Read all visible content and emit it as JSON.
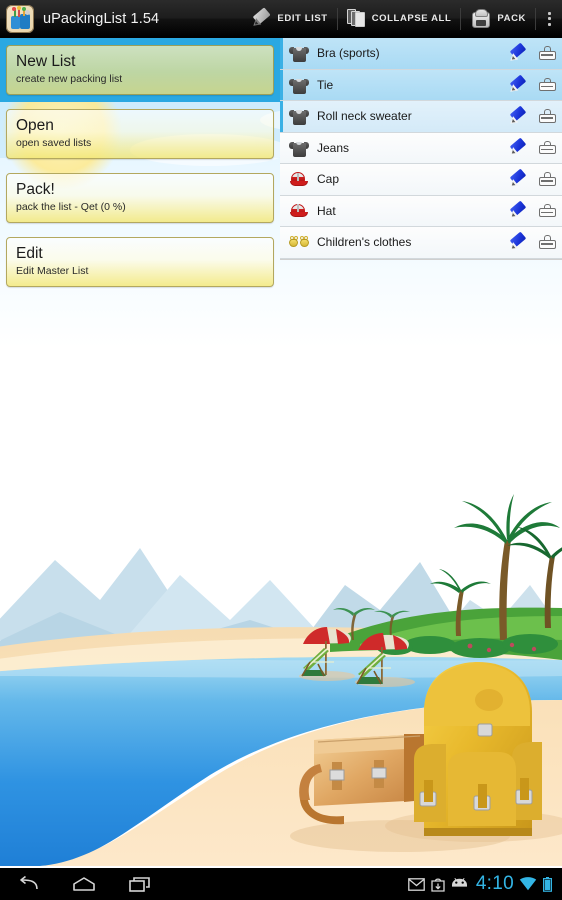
{
  "actionbar": {
    "app_icon": "app-gift-icon",
    "title": "uPackingList 1.54",
    "buttons": [
      {
        "icon": "pencil-icon",
        "label": "EDIT LIST"
      },
      {
        "icon": "layers-icon",
        "label": "COLLAPSE ALL"
      },
      {
        "icon": "backpack-icon",
        "label": "PACK"
      }
    ],
    "overflow": "overflow-menu-icon"
  },
  "menu": {
    "items": [
      {
        "title": "New List",
        "subtitle": "create new packing list",
        "selected": true
      },
      {
        "title": "Open",
        "subtitle": "open saved lists",
        "selected": false
      },
      {
        "title": "Pack!",
        "subtitle": "pack the list - Qet (0 %)",
        "selected": false
      },
      {
        "title": "Edit",
        "subtitle": "Edit Master List",
        "selected": false
      }
    ]
  },
  "list": {
    "rows": [
      {
        "label": "Bra (sports)",
        "icon": "tshirt-icon",
        "state": "selected"
      },
      {
        "label": "Tie",
        "icon": "tshirt-icon",
        "state": "selected"
      },
      {
        "label": "Roll neck sweater",
        "icon": "tshirt-icon",
        "state": "highlight"
      },
      {
        "label": "Jeans",
        "icon": "tshirt-icon",
        "state": "normal"
      },
      {
        "label": "Cap",
        "icon": "cap-icon",
        "state": "normal"
      },
      {
        "label": "Hat",
        "icon": "cap-icon",
        "state": "normal"
      },
      {
        "label": "Children's clothes",
        "icon": "booties-icon",
        "state": "normal"
      }
    ],
    "row_actions": {
      "edit": "blue-pencil-icon",
      "pack": "bag-icon"
    }
  },
  "navbar": {
    "back": "back-icon",
    "home": "home-icon",
    "recents": "recents-icon",
    "status_icons": [
      "gmail-icon",
      "download-icon",
      "android-icon"
    ],
    "clock": "4:10",
    "wifi": "wifi-icon",
    "battery": "battery-icon"
  },
  "colors": {
    "accent_blue": "#2aa8e2",
    "clock_blue": "#33b5e5",
    "menu_yellow": "#f3e87a",
    "pencil_blue": "#1a33d8",
    "sea": "#2e90e0",
    "sand": "#f7d9a8"
  }
}
